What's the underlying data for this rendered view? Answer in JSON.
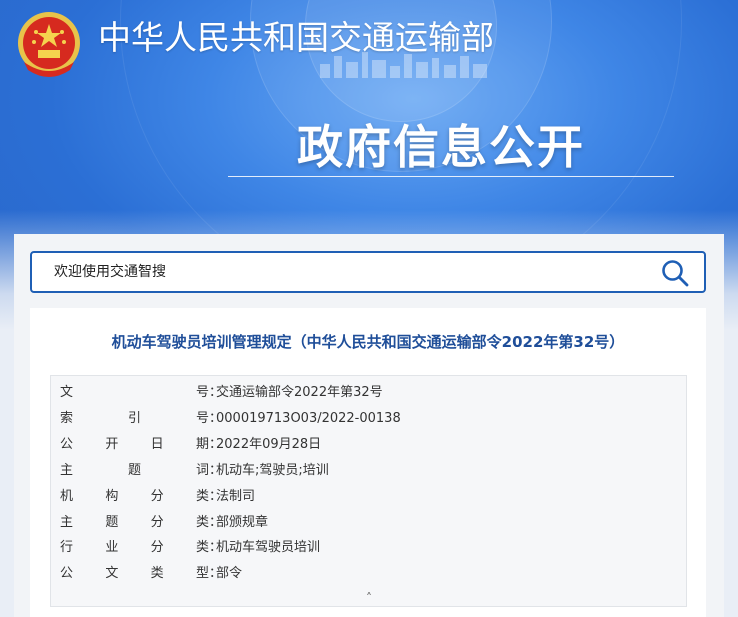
{
  "header": {
    "ministry_name": "中华人民共和国交通运输部",
    "section_title": "政府信息公开",
    "emblem_icon": "national-emblem-icon"
  },
  "search": {
    "value": "欢迎使用交通智搜",
    "icon": "search-icon"
  },
  "document": {
    "title": "机动车驾驶员培训管理规定（中华人民共和国交通运输部令2022年第32号）",
    "meta": [
      {
        "label": [
          "文",
          "号"
        ],
        "value": "交通运输部令2022年第32号"
      },
      {
        "label": [
          "索",
          "引",
          "号"
        ],
        "value": "000019713O03/2022-00138"
      },
      {
        "label": [
          "公",
          "开",
          "日",
          "期"
        ],
        "value": "2022年09月28日"
      },
      {
        "label": [
          "主",
          "题",
          "词"
        ],
        "value": "机动车;驾驶员;培训"
      },
      {
        "label": [
          "机",
          "构",
          "分",
          "类"
        ],
        "value": "法制司"
      },
      {
        "label": [
          "主",
          "题",
          "分",
          "类"
        ],
        "value": "部颁规章"
      },
      {
        "label": [
          "行",
          "业",
          "分",
          "类"
        ],
        "value": "机动车驾驶员培训"
      },
      {
        "label": [
          "公",
          "文",
          "类",
          "型"
        ],
        "value": "部令"
      }
    ],
    "colon": "：",
    "collapse_icon": "chevron-up-icon",
    "collapse_glyph": "˄"
  },
  "colors": {
    "banner": "#2b6fd5",
    "title_blue": "#1f4e99",
    "search_border": "#1f5fb5"
  }
}
